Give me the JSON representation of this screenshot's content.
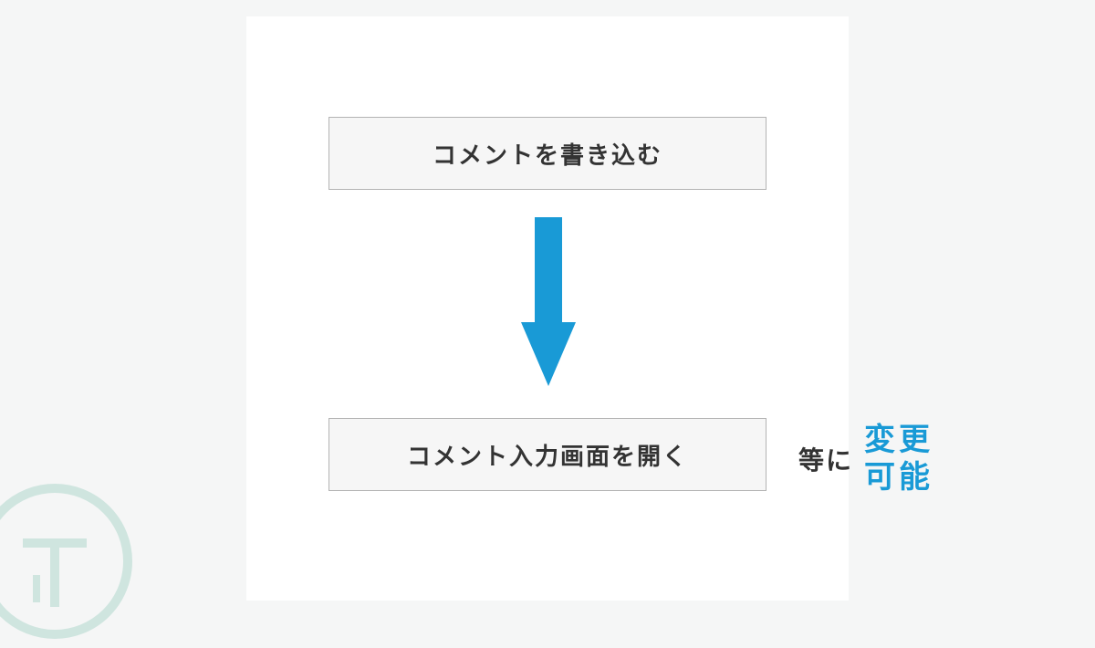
{
  "diagram": {
    "box_top_label": "コメントを書き込む",
    "box_bottom_label": "コメント入力画面を開く"
  },
  "side": {
    "prefix": "等に",
    "line1": "変更",
    "line2": "可能"
  },
  "colors": {
    "accent": "#199ad6",
    "logo_stroke": "#cfe5df"
  }
}
